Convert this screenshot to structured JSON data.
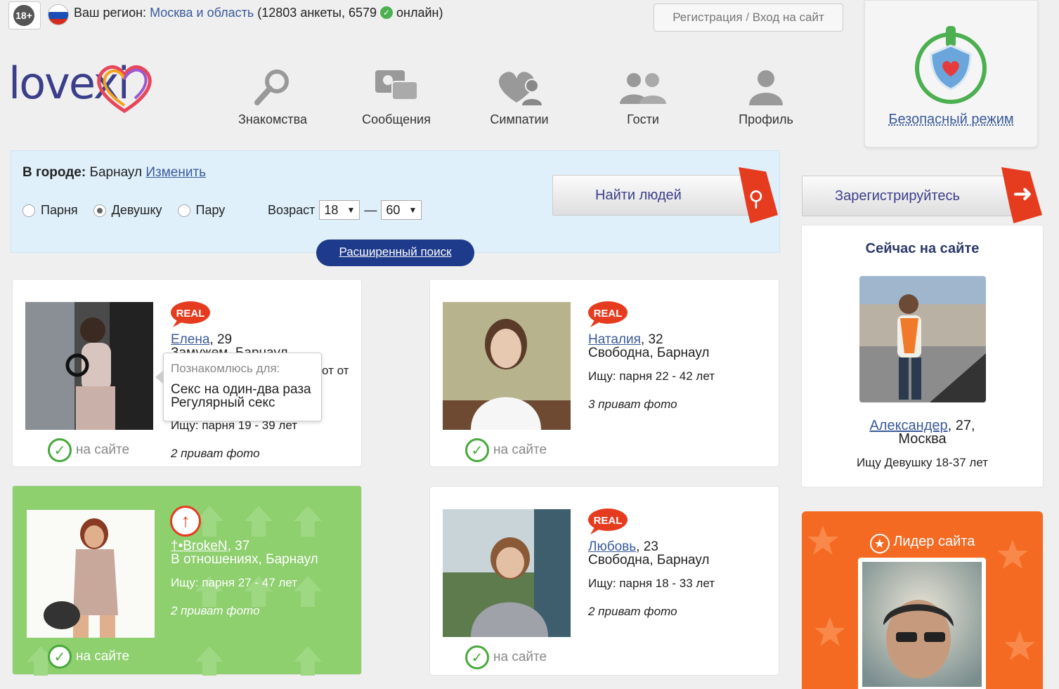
{
  "topbar": {
    "age_badge": "18+",
    "region_label": "Ваш регион:",
    "region_name": "Москва и область",
    "stats_before": "(12803 анкеты, 6579",
    "stats_after": "онлайн)",
    "register_link": "Регистрация",
    "separator": "/",
    "login_link": "Вход на сайт"
  },
  "logo": {
    "text": "lovexi"
  },
  "nav": [
    {
      "label": "Знакомства",
      "icon": "magnifier-icon"
    },
    {
      "label": "Сообщения",
      "icon": "messages-icon"
    },
    {
      "label": "Симпатии",
      "icon": "heart-person-icon"
    },
    {
      "label": "Гости",
      "icon": "guests-icon"
    },
    {
      "label": "Профиль",
      "icon": "profile-icon"
    }
  ],
  "safe_mode": {
    "label": "Безопасный режим"
  },
  "search": {
    "city_label": "В городе:",
    "city": "Барнаул",
    "change_link": "Изменить",
    "options": [
      "Парня",
      "Девушку",
      "Пару"
    ],
    "selected": "Девушку",
    "age_label": "Возраст",
    "age_from": "18",
    "age_dash": "—",
    "age_to": "60",
    "find_button": "Найти людей",
    "advanced_button": "Расширенный поиск"
  },
  "register_button": "Зарегистрируйтесь",
  "cards": [
    {
      "name": "Елена",
      "age": ", 29",
      "status_line": "Замужем, Барнаул",
      "seek": "Ищу: парня 19 - 39 лет",
      "private": "2 приват фото",
      "online": "на сайте",
      "badge": "REAL",
      "hidden_tail": "от от"
    },
    {
      "name": "Наталия",
      "age": ", 32",
      "status_line": "Свободна, Барнаул",
      "seek": "Ищу: парня 22 - 42 лет",
      "private": "3 приват фото",
      "online": "на сайте",
      "badge": "REAL"
    },
    {
      "name": "†•BrokeN",
      "age": ", 37",
      "status_line": "В отношениях, Барнаул",
      "seek": "Ищу: парня 27 - 47 лет",
      "private": "2 приват фото",
      "online": "на сайте"
    },
    {
      "name": "Любовь",
      "age": ", 23",
      "status_line": "Свободна, Барнаул",
      "seek": "Ищу: парня 18 - 33 лет",
      "private": "2 приват фото",
      "online": "на сайте",
      "badge": "REAL"
    }
  ],
  "tooltip": {
    "title": "Познакомлюсь для:",
    "line1": "Секс на один-два раза",
    "line2": "Регулярный секс"
  },
  "online_now": {
    "title": "Сейчас на сайте",
    "name": "Александер",
    "age": ", 27,",
    "city": "Москва",
    "seek": "Ищу Девушку 18-37 лет"
  },
  "leader": {
    "title": "Лидер сайта"
  },
  "colors": {
    "accent_blue": "#3b3f8a",
    "link": "#3a5a9a",
    "orange": "#e53b1f",
    "green_card": "#8ecf6e",
    "search_bg": "#dff0fb"
  }
}
